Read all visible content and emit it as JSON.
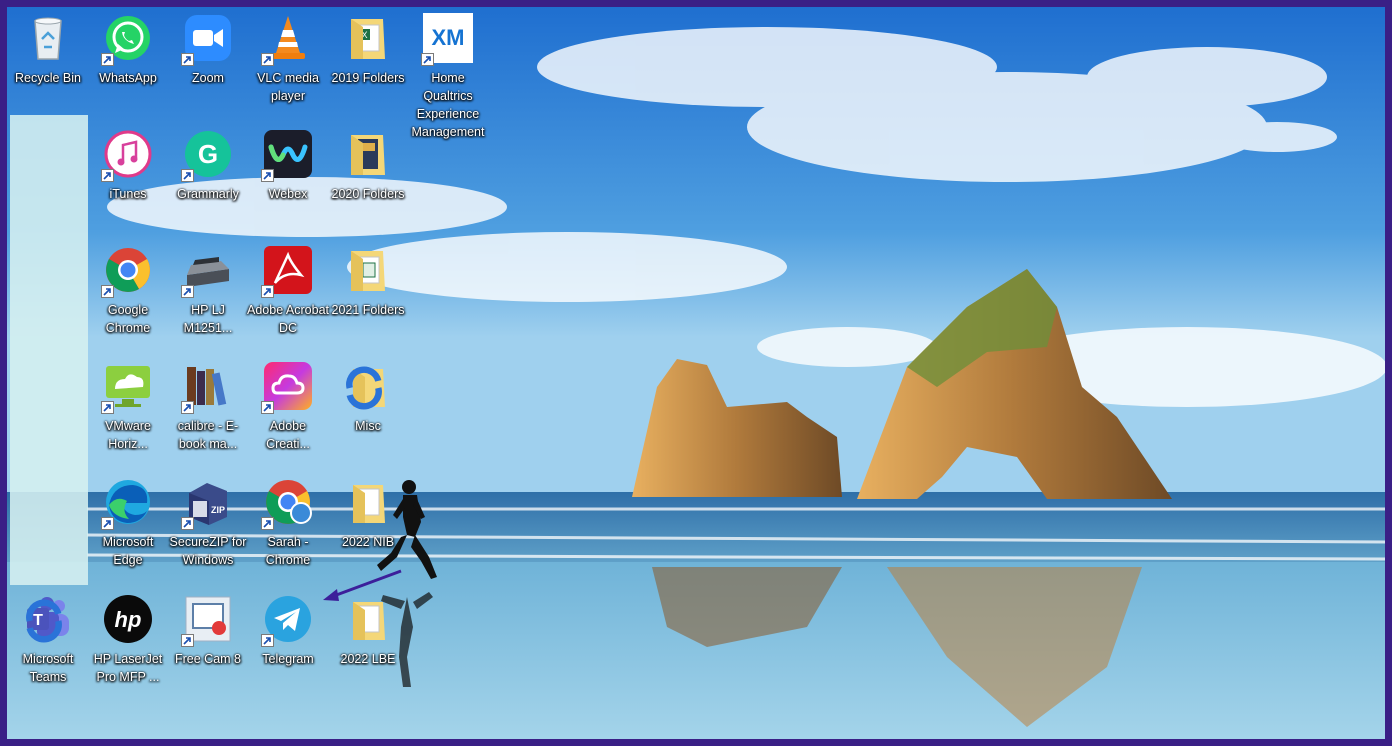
{
  "desktop": {
    "icons": [
      {
        "id": "recycle-bin",
        "label": "Recycle Bin"
      },
      {
        "id": "whatsapp",
        "label": "WhatsApp"
      },
      {
        "id": "zoom",
        "label": "Zoom"
      },
      {
        "id": "vlc",
        "label": "VLC media player"
      },
      {
        "id": "folders-2019",
        "label": "2019 Folders"
      },
      {
        "id": "qualtrics",
        "label": "Home Qualtrics Experience Management",
        "logo_text": "XM"
      },
      {
        "id": "itunes",
        "label": "iTunes"
      },
      {
        "id": "grammarly",
        "label": "Grammarly",
        "logo_text": "G"
      },
      {
        "id": "webex",
        "label": "Webex"
      },
      {
        "id": "folders-2020",
        "label": "2020 Folders"
      },
      {
        "id": "chrome",
        "label": "Google Chrome"
      },
      {
        "id": "hp-lj",
        "label": "HP LJ M1251..."
      },
      {
        "id": "acrobat",
        "label": "Adobe Acrobat DC"
      },
      {
        "id": "folders-2021",
        "label": "2021 Folders"
      },
      {
        "id": "vmware",
        "label": "VMware Horiz..."
      },
      {
        "id": "calibre",
        "label": "calibre - E-book ma..."
      },
      {
        "id": "adobe-cc",
        "label": "Adobe Creati..."
      },
      {
        "id": "misc",
        "label": "Misc"
      },
      {
        "id": "edge",
        "label": "Microsoft Edge"
      },
      {
        "id": "securezip",
        "label": "SecureZIP for Windows",
        "logo_text": "ZIP"
      },
      {
        "id": "sarah-chrome",
        "label": "Sarah - Chrome"
      },
      {
        "id": "nib-2022",
        "label": "2022 NIB"
      },
      {
        "id": "teams",
        "label": "Microsoft Teams",
        "logo_text": "T"
      },
      {
        "id": "hp-laserjet",
        "label": "HP LaserJet Pro MFP ...",
        "logo_text": "hp"
      },
      {
        "id": "free-cam",
        "label": "Free Cam 8"
      },
      {
        "id": "telegram",
        "label": "Telegram"
      },
      {
        "id": "lbe-2022",
        "label": "2022 LBE"
      }
    ]
  },
  "colors": {
    "frame": "#3a1f86",
    "annotation_arrow": "#3c1f9a",
    "selection_band": "#d6f0f0"
  }
}
